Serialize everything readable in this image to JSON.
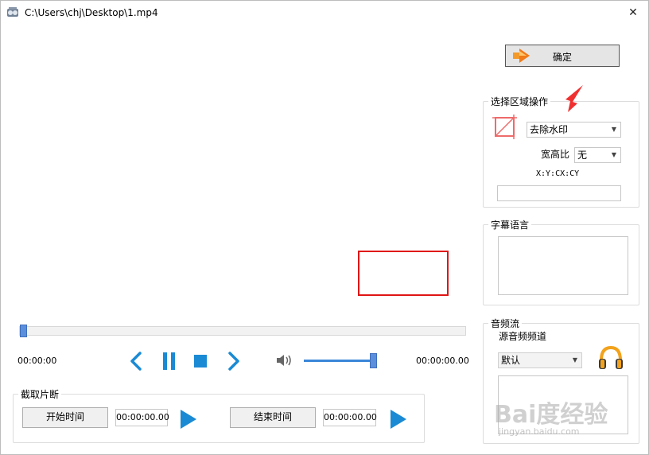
{
  "window": {
    "title": "C:\\Users\\chj\\Desktop\\1.mp4",
    "close_glyph": "✕"
  },
  "player": {
    "time_current": "00:00:00",
    "time_total": "00:00:00.00",
    "volume_fraction": 0.95,
    "position_fraction": 0.0
  },
  "clip": {
    "legend": "截取片断",
    "start_label": "开始时间",
    "start_value": "00:00:00.00",
    "end_label": "结束时间",
    "end_value": "00:00:00.00"
  },
  "confirm": {
    "label": "确定"
  },
  "region": {
    "legend": "选择区域操作",
    "operation": "去除水印",
    "aspect_label": "宽高比",
    "aspect_value": "无",
    "coords_label": "X:Y:CX:CY",
    "coords_value": ""
  },
  "subtitle": {
    "legend": "字幕语言"
  },
  "audio": {
    "legend": "音频流",
    "source_label": "源音频频道",
    "source_value": "默认"
  },
  "watermark": {
    "big": "Bai度经验",
    "small": "jingyan.baidu.com"
  },
  "colors": {
    "accent": "#1a8ad4",
    "selection": "#e01515",
    "thumb": "#5b8fdc"
  }
}
